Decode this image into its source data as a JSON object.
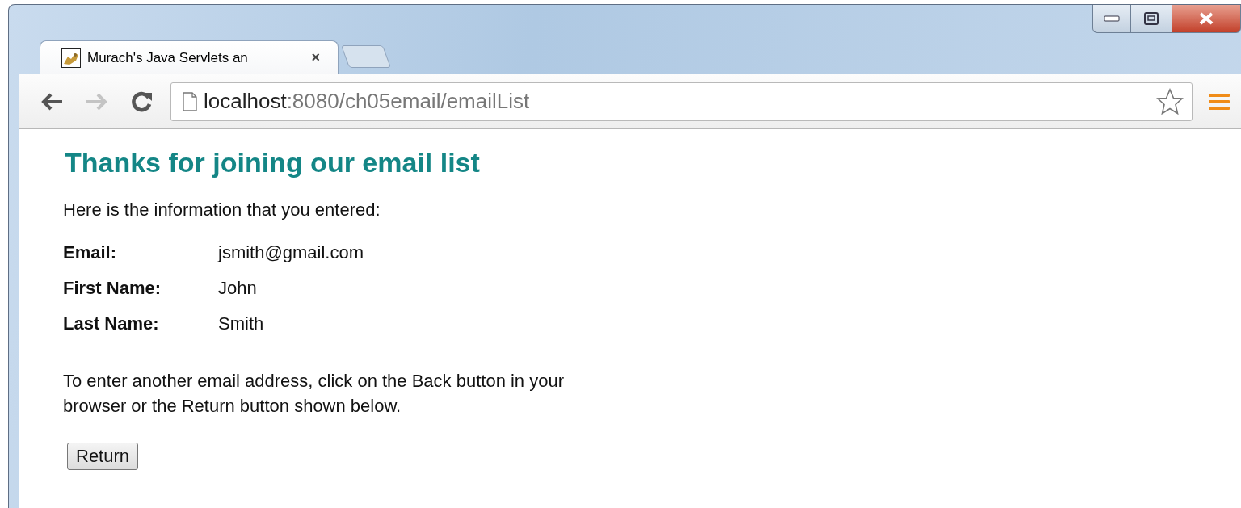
{
  "tabs": [
    {
      "title": "Murach's Java Servlets an",
      "selected": true,
      "close": "×"
    }
  ],
  "nav_buttons": [
    {
      "kind": "back",
      "disabled": false
    },
    {
      "kind": "forward",
      "disabled": true
    },
    {
      "kind": "reload",
      "disabled": false
    }
  ],
  "address": {
    "host": "localhost",
    "path": ":8080/ch05email/emailList"
  },
  "page": {
    "heading": "Thanks for joining our email list",
    "intro": "Here is the information that you entered:",
    "fields": [
      {
        "label": "Email:",
        "value": "jsmith@gmail.com"
      },
      {
        "label": "First Name:",
        "value": "John"
      },
      {
        "label": "Last Name:",
        "value": "Smith"
      }
    ],
    "note": "To enter another email address, click on the Back button in your browser or the Return button shown below.",
    "button": "Return"
  }
}
